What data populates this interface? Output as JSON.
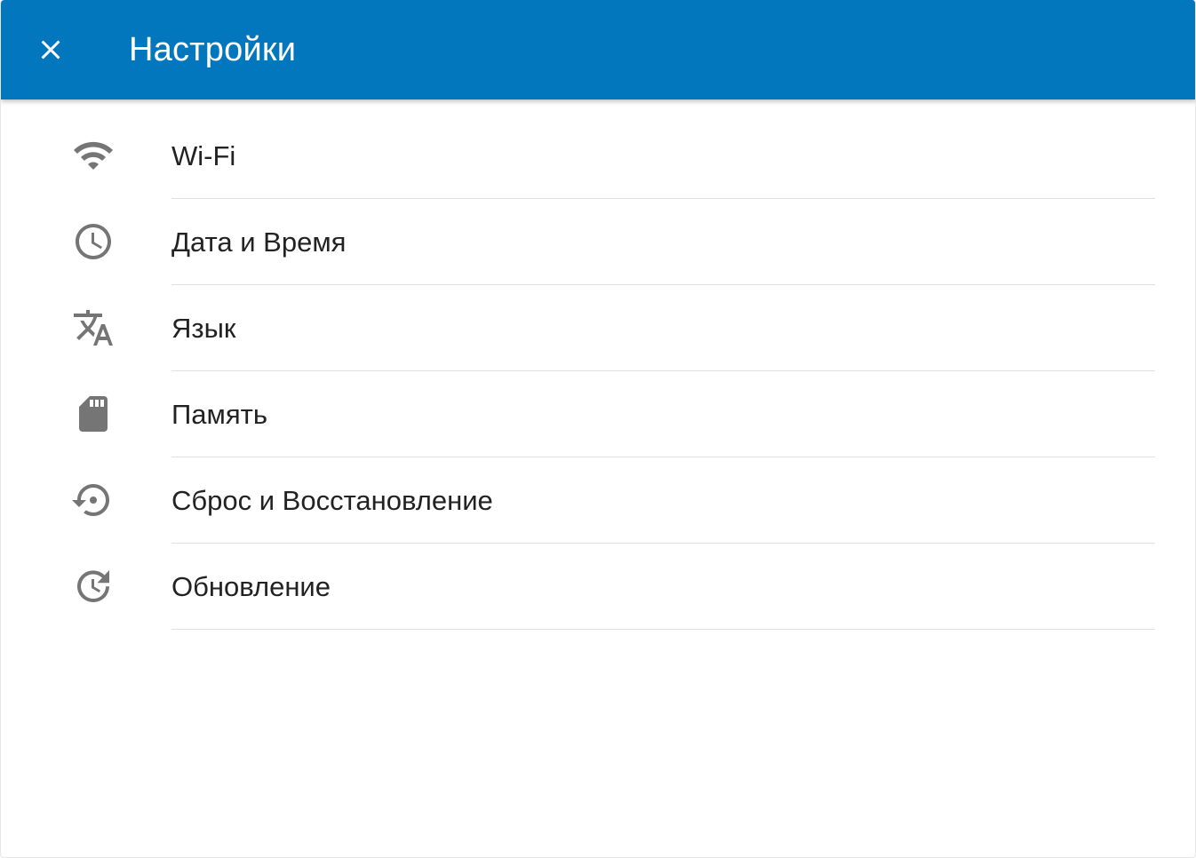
{
  "header": {
    "title": "Настройки",
    "close_icon": "close-icon",
    "background_color": "#0277bd"
  },
  "settings": {
    "items": [
      {
        "label": "Wi-Fi",
        "icon": "wifi-icon"
      },
      {
        "label": "Дата и Время",
        "icon": "clock-icon"
      },
      {
        "label": "Язык",
        "icon": "translate-icon"
      },
      {
        "label": "Память",
        "icon": "sd-card-icon"
      },
      {
        "label": "Сброс и Восстановление",
        "icon": "restore-icon"
      },
      {
        "label": "Обновление",
        "icon": "update-icon"
      }
    ]
  },
  "colors": {
    "accent": "#0277bd",
    "icon": "#757575",
    "text": "#222222",
    "divider": "#e0e0e0"
  }
}
